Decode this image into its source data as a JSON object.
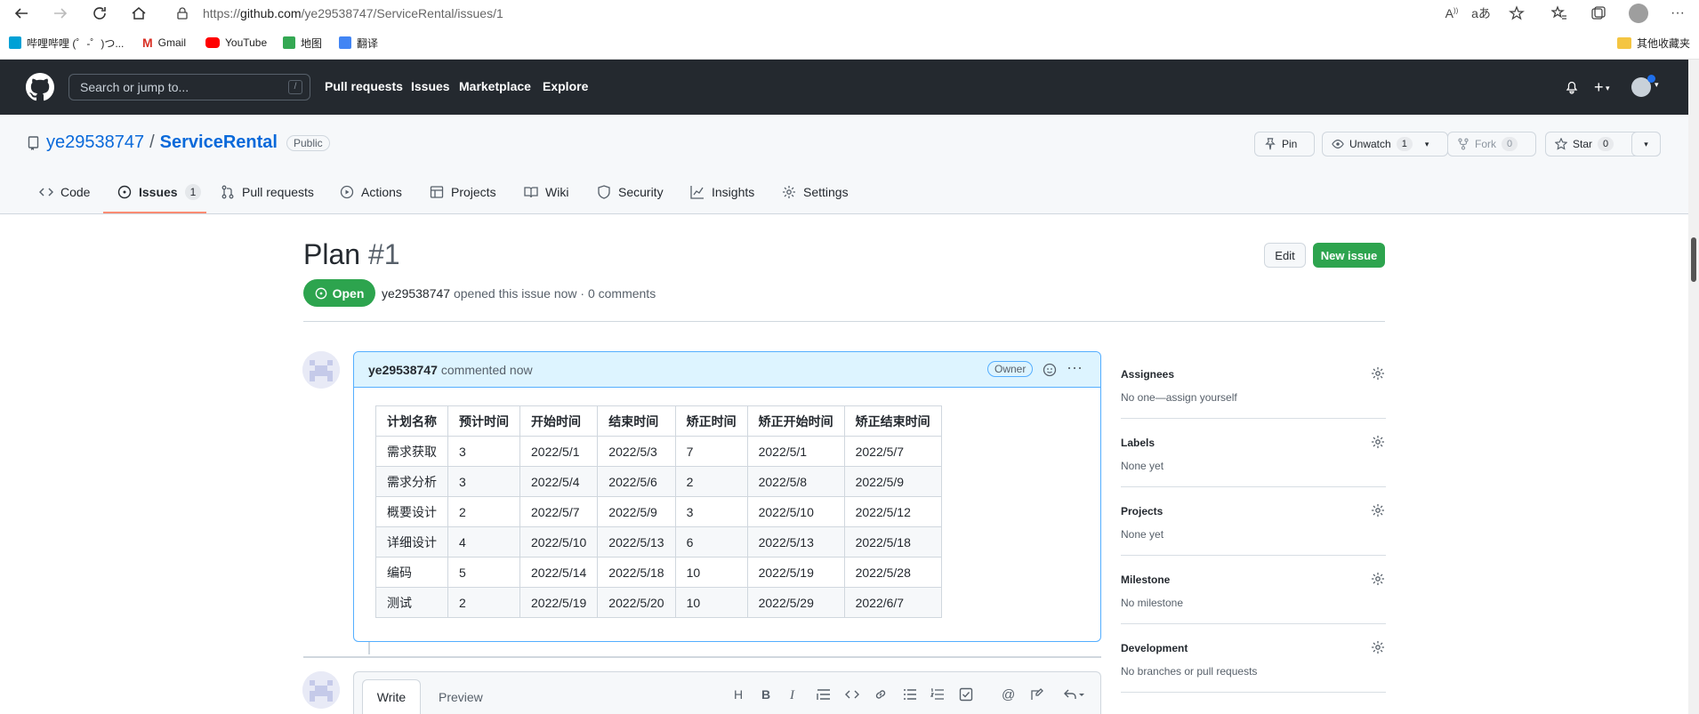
{
  "browser": {
    "url_prefix": "https://",
    "url_host": "github.com",
    "url_path": "/ye29538747/ServiceRental/issues/1",
    "bookmarks": [
      {
        "label": "哔哩哔哩 (゜-゜)つ...",
        "color": "#00a1d6",
        "icon": "bilibili-icon"
      },
      {
        "label": "Gmail",
        "color": "#d93025",
        "icon": "gmail-icon"
      },
      {
        "label": "YouTube",
        "color": "#ff0000",
        "icon": "youtube-icon"
      },
      {
        "label": "地图",
        "color": "#34a853",
        "icon": "maps-icon"
      },
      {
        "label": "翻译",
        "color": "#4285f4",
        "icon": "translate-icon"
      }
    ],
    "other_bookmarks": "其他收藏夹"
  },
  "github": {
    "search_placeholder": "Search or jump to...",
    "search_shortcut": "/",
    "nav": [
      "Pull requests",
      "Issues",
      "Marketplace",
      "Explore"
    ]
  },
  "repo": {
    "owner": "ye29538747",
    "separator": "/",
    "name": "ServiceRental",
    "visibility": "Public",
    "pin_label": "Pin",
    "watch_label": "Unwatch",
    "watch_count": "1",
    "fork_label": "Fork",
    "fork_count": "0",
    "star_label": "Star",
    "star_count": "0",
    "tabs": [
      {
        "label": "Code",
        "icon": "code-icon"
      },
      {
        "label": "Issues",
        "icon": "issue-opened-icon",
        "count": "1",
        "selected": true
      },
      {
        "label": "Pull requests",
        "icon": "git-pull-request-icon"
      },
      {
        "label": "Actions",
        "icon": "play-icon"
      },
      {
        "label": "Projects",
        "icon": "table-icon"
      },
      {
        "label": "Wiki",
        "icon": "book-icon"
      },
      {
        "label": "Security",
        "icon": "shield-icon"
      },
      {
        "label": "Insights",
        "icon": "graph-icon"
      },
      {
        "label": "Settings",
        "icon": "gear-icon"
      }
    ]
  },
  "issue": {
    "title": "Plan",
    "number": "#1",
    "state": "Open",
    "author": "ye29538747",
    "meta": "opened this issue now · 0 comments",
    "edit_label": "Edit",
    "new_issue_label": "New issue"
  },
  "comment": {
    "author": "ye29538747",
    "time": "commented now",
    "badge": "Owner",
    "table": {
      "headers": [
        "计划名称",
        "预计时间",
        "开始时间",
        "结束时间",
        "矫正时间",
        "矫正开始时间",
        "矫正结束时间"
      ],
      "rows": [
        [
          "需求获取",
          "3",
          "2022/5/1",
          "2022/5/3",
          "7",
          "2022/5/1",
          "2022/5/7"
        ],
        [
          "需求分析",
          "3",
          "2022/5/4",
          "2022/5/6",
          "2",
          "2022/5/8",
          "2022/5/9"
        ],
        [
          "概要设计",
          "2",
          "2022/5/7",
          "2022/5/9",
          "3",
          "2022/5/10",
          "2022/5/12"
        ],
        [
          "详细设计",
          "4",
          "2022/5/10",
          "2022/5/13",
          "6",
          "2022/5/13",
          "2022/5/18"
        ],
        [
          "编码",
          "5",
          "2022/5/14",
          "2022/5/18",
          "10",
          "2022/5/19",
          "2022/5/28"
        ],
        [
          "测试",
          "2",
          "2022/5/19",
          "2022/5/20",
          "10",
          "2022/5/29",
          "2022/6/7"
        ]
      ]
    }
  },
  "sidebar": [
    {
      "heading": "Assignees",
      "value": "No one—assign yourself"
    },
    {
      "heading": "Labels",
      "value": "None yet"
    },
    {
      "heading": "Projects",
      "value": "None yet"
    },
    {
      "heading": "Milestone",
      "value": "No milestone"
    },
    {
      "heading": "Development",
      "value": "No branches or pull requests"
    }
  ],
  "editor": {
    "write_tab": "Write",
    "preview_tab": "Preview"
  },
  "colors": {
    "header_bg": "#24292f",
    "open_green": "#2da44e",
    "link_blue": "#0969da",
    "active_tab_underline": "#fd8c73"
  }
}
